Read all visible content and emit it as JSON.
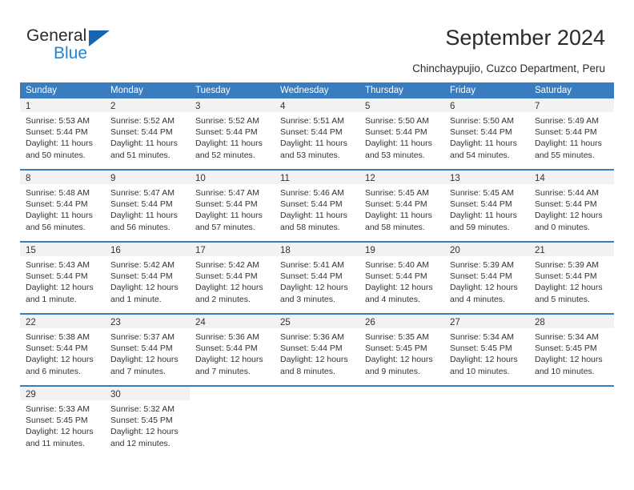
{
  "logo": {
    "word_top": "General",
    "word_bottom": "Blue",
    "triangle_color": "#1565b0",
    "bottom_color": "#1f84d6"
  },
  "header": {
    "title": "September 2024",
    "subtitle": "Chinchaypujio, Cuzco Department, Peru"
  },
  "colors": {
    "header_band": "#3a7cc0",
    "week_divider": "#3a7cc0",
    "daynum_band": "#f2f2f2",
    "text": "#333333"
  },
  "weekdays": [
    "Sunday",
    "Monday",
    "Tuesday",
    "Wednesday",
    "Thursday",
    "Friday",
    "Saturday"
  ],
  "weeks": [
    [
      {
        "day": "1",
        "lines": [
          "Sunrise: 5:53 AM",
          "Sunset: 5:44 PM",
          "Daylight: 11 hours",
          "and 50 minutes."
        ]
      },
      {
        "day": "2",
        "lines": [
          "Sunrise: 5:52 AM",
          "Sunset: 5:44 PM",
          "Daylight: 11 hours",
          "and 51 minutes."
        ]
      },
      {
        "day": "3",
        "lines": [
          "Sunrise: 5:52 AM",
          "Sunset: 5:44 PM",
          "Daylight: 11 hours",
          "and 52 minutes."
        ]
      },
      {
        "day": "4",
        "lines": [
          "Sunrise: 5:51 AM",
          "Sunset: 5:44 PM",
          "Daylight: 11 hours",
          "and 53 minutes."
        ]
      },
      {
        "day": "5",
        "lines": [
          "Sunrise: 5:50 AM",
          "Sunset: 5:44 PM",
          "Daylight: 11 hours",
          "and 53 minutes."
        ]
      },
      {
        "day": "6",
        "lines": [
          "Sunrise: 5:50 AM",
          "Sunset: 5:44 PM",
          "Daylight: 11 hours",
          "and 54 minutes."
        ]
      },
      {
        "day": "7",
        "lines": [
          "Sunrise: 5:49 AM",
          "Sunset: 5:44 PM",
          "Daylight: 11 hours",
          "and 55 minutes."
        ]
      }
    ],
    [
      {
        "day": "8",
        "lines": [
          "Sunrise: 5:48 AM",
          "Sunset: 5:44 PM",
          "Daylight: 11 hours",
          "and 56 minutes."
        ]
      },
      {
        "day": "9",
        "lines": [
          "Sunrise: 5:47 AM",
          "Sunset: 5:44 PM",
          "Daylight: 11 hours",
          "and 56 minutes."
        ]
      },
      {
        "day": "10",
        "lines": [
          "Sunrise: 5:47 AM",
          "Sunset: 5:44 PM",
          "Daylight: 11 hours",
          "and 57 minutes."
        ]
      },
      {
        "day": "11",
        "lines": [
          "Sunrise: 5:46 AM",
          "Sunset: 5:44 PM",
          "Daylight: 11 hours",
          "and 58 minutes."
        ]
      },
      {
        "day": "12",
        "lines": [
          "Sunrise: 5:45 AM",
          "Sunset: 5:44 PM",
          "Daylight: 11 hours",
          "and 58 minutes."
        ]
      },
      {
        "day": "13",
        "lines": [
          "Sunrise: 5:45 AM",
          "Sunset: 5:44 PM",
          "Daylight: 11 hours",
          "and 59 minutes."
        ]
      },
      {
        "day": "14",
        "lines": [
          "Sunrise: 5:44 AM",
          "Sunset: 5:44 PM",
          "Daylight: 12 hours",
          "and 0 minutes."
        ]
      }
    ],
    [
      {
        "day": "15",
        "lines": [
          "Sunrise: 5:43 AM",
          "Sunset: 5:44 PM",
          "Daylight: 12 hours",
          "and 1 minute."
        ]
      },
      {
        "day": "16",
        "lines": [
          "Sunrise: 5:42 AM",
          "Sunset: 5:44 PM",
          "Daylight: 12 hours",
          "and 1 minute."
        ]
      },
      {
        "day": "17",
        "lines": [
          "Sunrise: 5:42 AM",
          "Sunset: 5:44 PM",
          "Daylight: 12 hours",
          "and 2 minutes."
        ]
      },
      {
        "day": "18",
        "lines": [
          "Sunrise: 5:41 AM",
          "Sunset: 5:44 PM",
          "Daylight: 12 hours",
          "and 3 minutes."
        ]
      },
      {
        "day": "19",
        "lines": [
          "Sunrise: 5:40 AM",
          "Sunset: 5:44 PM",
          "Daylight: 12 hours",
          "and 4 minutes."
        ]
      },
      {
        "day": "20",
        "lines": [
          "Sunrise: 5:39 AM",
          "Sunset: 5:44 PM",
          "Daylight: 12 hours",
          "and 4 minutes."
        ]
      },
      {
        "day": "21",
        "lines": [
          "Sunrise: 5:39 AM",
          "Sunset: 5:44 PM",
          "Daylight: 12 hours",
          "and 5 minutes."
        ]
      }
    ],
    [
      {
        "day": "22",
        "lines": [
          "Sunrise: 5:38 AM",
          "Sunset: 5:44 PM",
          "Daylight: 12 hours",
          "and 6 minutes."
        ]
      },
      {
        "day": "23",
        "lines": [
          "Sunrise: 5:37 AM",
          "Sunset: 5:44 PM",
          "Daylight: 12 hours",
          "and 7 minutes."
        ]
      },
      {
        "day": "24",
        "lines": [
          "Sunrise: 5:36 AM",
          "Sunset: 5:44 PM",
          "Daylight: 12 hours",
          "and 7 minutes."
        ]
      },
      {
        "day": "25",
        "lines": [
          "Sunrise: 5:36 AM",
          "Sunset: 5:44 PM",
          "Daylight: 12 hours",
          "and 8 minutes."
        ]
      },
      {
        "day": "26",
        "lines": [
          "Sunrise: 5:35 AM",
          "Sunset: 5:45 PM",
          "Daylight: 12 hours",
          "and 9 minutes."
        ]
      },
      {
        "day": "27",
        "lines": [
          "Sunrise: 5:34 AM",
          "Sunset: 5:45 PM",
          "Daylight: 12 hours",
          "and 10 minutes."
        ]
      },
      {
        "day": "28",
        "lines": [
          "Sunrise: 5:34 AM",
          "Sunset: 5:45 PM",
          "Daylight: 12 hours",
          "and 10 minutes."
        ]
      }
    ],
    [
      {
        "day": "29",
        "lines": [
          "Sunrise: 5:33 AM",
          "Sunset: 5:45 PM",
          "Daylight: 12 hours",
          "and 11 minutes."
        ]
      },
      {
        "day": "30",
        "lines": [
          "Sunrise: 5:32 AM",
          "Sunset: 5:45 PM",
          "Daylight: 12 hours",
          "and 12 minutes."
        ]
      },
      {
        "day": "",
        "lines": []
      },
      {
        "day": "",
        "lines": []
      },
      {
        "day": "",
        "lines": []
      },
      {
        "day": "",
        "lines": []
      },
      {
        "day": "",
        "lines": []
      }
    ]
  ]
}
